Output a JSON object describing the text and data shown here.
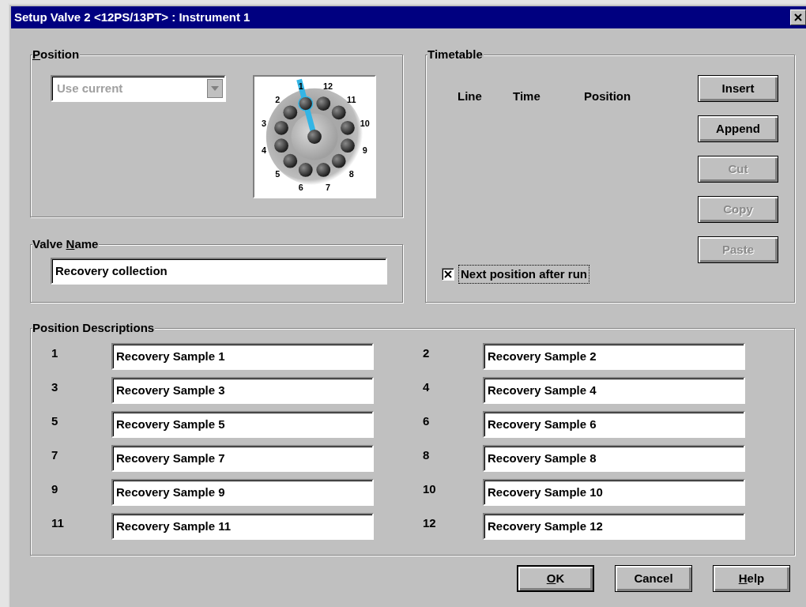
{
  "window": {
    "title": "Setup Valve 2 <12PS/13PT> : Instrument 1"
  },
  "position": {
    "label": {
      "key": "P",
      "rest": "osition"
    },
    "combo": {
      "value": "Use current",
      "disabled": true
    },
    "ports": [
      {
        "label": "1",
        "selected": true
      },
      {
        "label": "2",
        "selected": false
      },
      {
        "label": "3",
        "selected": false
      },
      {
        "label": "4",
        "selected": false
      },
      {
        "label": "5",
        "selected": false
      },
      {
        "label": "6",
        "selected": false
      },
      {
        "label": "7",
        "selected": false
      },
      {
        "label": "8",
        "selected": false
      },
      {
        "label": "9",
        "selected": false
      },
      {
        "label": "10",
        "selected": false
      },
      {
        "label": "11",
        "selected": false
      },
      {
        "label": "12",
        "selected": false
      }
    ]
  },
  "valve_name": {
    "label": {
      "before": "Valve ",
      "key": "N",
      "rest": "ame"
    },
    "value": "Recovery collection"
  },
  "timetable": {
    "label": "Timetable",
    "columns": [
      "Line",
      "Time",
      "Position"
    ],
    "buttons": [
      {
        "label": "Insert",
        "disabled": false
      },
      {
        "label": "Append",
        "disabled": false
      },
      {
        "label": "Cut",
        "disabled": true
      },
      {
        "label": "Copy",
        "disabled": true
      },
      {
        "label": "Paste",
        "disabled": true
      }
    ],
    "next_position": {
      "label": "Next position after run",
      "checked": true,
      "focused": true
    }
  },
  "descriptions": {
    "label": "Position Descriptions",
    "items": [
      {
        "number": "1",
        "value": "Recovery Sample 1"
      },
      {
        "number": "2",
        "value": "Recovery Sample 2"
      },
      {
        "number": "3",
        "value": "Recovery Sample 3"
      },
      {
        "number": "4",
        "value": "Recovery Sample 4"
      },
      {
        "number": "5",
        "value": "Recovery Sample 5"
      },
      {
        "number": "6",
        "value": "Recovery Sample 6"
      },
      {
        "number": "7",
        "value": "Recovery Sample 7"
      },
      {
        "number": "8",
        "value": "Recovery Sample 8"
      },
      {
        "number": "9",
        "value": "Recovery Sample 9"
      },
      {
        "number": "10",
        "value": "Recovery Sample 10"
      },
      {
        "number": "11",
        "value": "Recovery Sample 11"
      },
      {
        "number": "12",
        "value": "Recovery Sample 12"
      }
    ]
  },
  "buttons": [
    {
      "label": {
        "key": "O",
        "rest": "K"
      },
      "default": true
    },
    {
      "label": {
        "before": "Cancel"
      },
      "default": false
    },
    {
      "label": {
        "key": "H",
        "rest": "elp"
      },
      "default": false
    }
  ]
}
